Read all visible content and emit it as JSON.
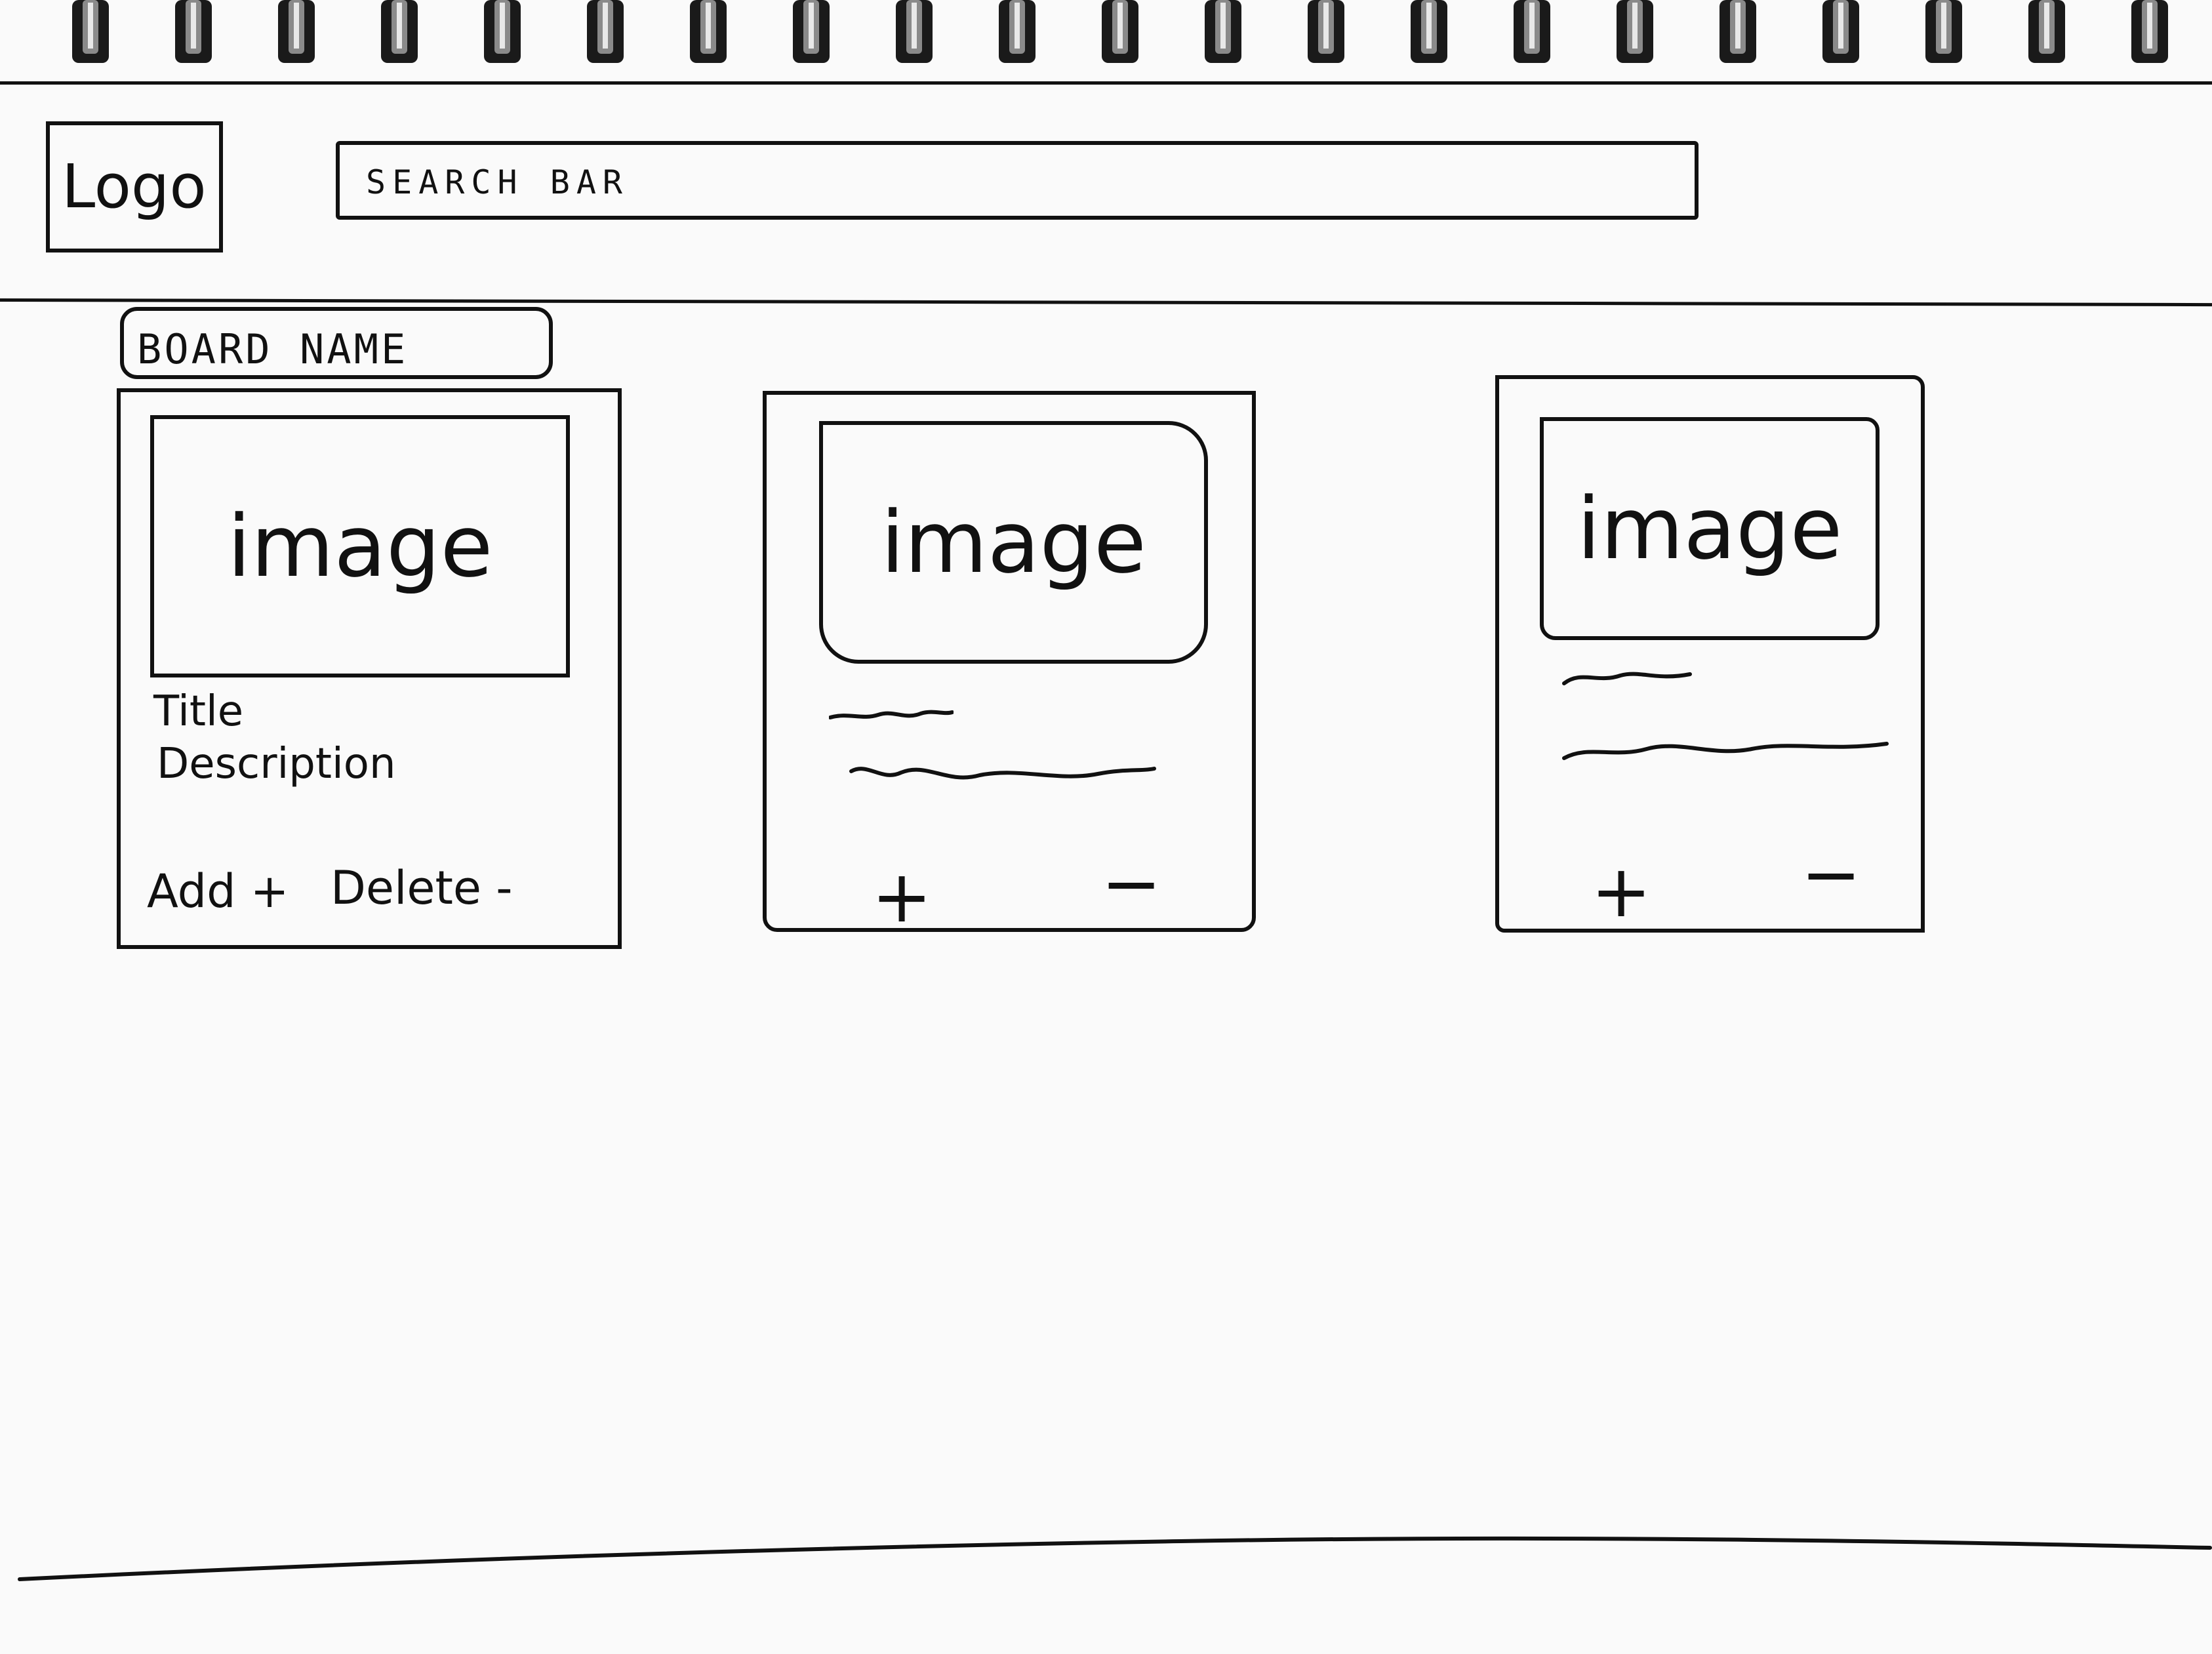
{
  "header": {
    "logo_label": "Logo",
    "search_label": "SEARCH BAR"
  },
  "board": {
    "name": "BOARD NAME"
  },
  "cards": [
    {
      "image_label": "image",
      "title": "Title",
      "description": "Description",
      "add_label": "Add +",
      "delete_label": "Delete -"
    },
    {
      "image_label": "image",
      "add_label": "+",
      "delete_label": "−"
    },
    {
      "image_label": "image",
      "add_label": "+",
      "delete_label": "−"
    }
  ]
}
